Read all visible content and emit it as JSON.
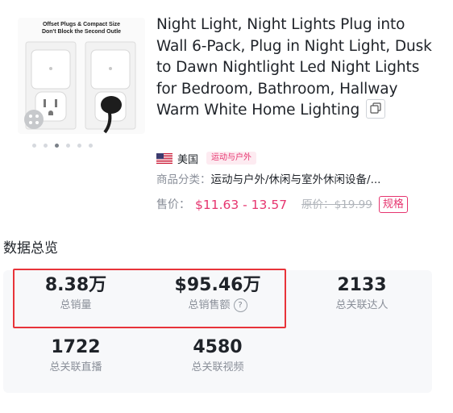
{
  "product": {
    "image_caption_line1": "Offset Plugs & Compact Size",
    "image_caption_line2": "Don't Block the Second Outle",
    "title": "Night Light, Night Lights Plug into Wall 6-Pack, Plug in Night Light, Dusk to Dawn Nightlight Led Night Lights for Bedroom, Bathroom, Hallway Warm White Home Lighting",
    "country": "美国",
    "category_tag": "运动与户外",
    "category_label": "商品分类：",
    "category_path": "运动与户外/休闲与室外休闲设备/...",
    "price_label": "售价：",
    "price_value": "$11.63 - 13.57",
    "original_price_label": "原价：",
    "original_price_value": "$19.99",
    "spec_button": "规格",
    "image_count": 6,
    "active_image_index": 2
  },
  "overview": {
    "section_title": "数据总览",
    "stats": [
      {
        "value": "8.38万",
        "label": "总销量"
      },
      {
        "value": "$95.46万",
        "label": "总销售额"
      },
      {
        "value": "2133",
        "label": "总关联达人"
      },
      {
        "value": "1722",
        "label": "总关联直播"
      },
      {
        "value": "4580",
        "label": "总关联视频"
      }
    ],
    "info_icon_glyph": "?"
  },
  "colors": {
    "accent": "#e6356f",
    "highlight": "#e8343a",
    "card_bg": "#f7f8fa"
  },
  "icons": [
    "copy-icon",
    "us-flag-icon",
    "info-icon"
  ]
}
